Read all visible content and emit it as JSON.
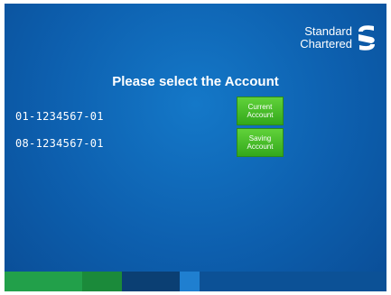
{
  "brand": {
    "line1": "Standard",
    "line2": "Chartered",
    "icon": "standard-chartered-logo"
  },
  "prompt": "Please select the Account",
  "accounts": [
    {
      "number": "01-1234567-01",
      "button_line1": "Current",
      "button_line2": "Account"
    },
    {
      "number": "08-1234567-01",
      "button_line1": "Saving",
      "button_line2": "Account"
    }
  ],
  "colors": {
    "background": "#0d5fae",
    "button": "#3dba22",
    "footer_green_light": "#22a04a",
    "footer_green_dark": "#1b8a3a",
    "footer_navy": "#0b3f73",
    "footer_blue_accent": "#1f7fd0",
    "footer_blue": "#0c5196"
  }
}
